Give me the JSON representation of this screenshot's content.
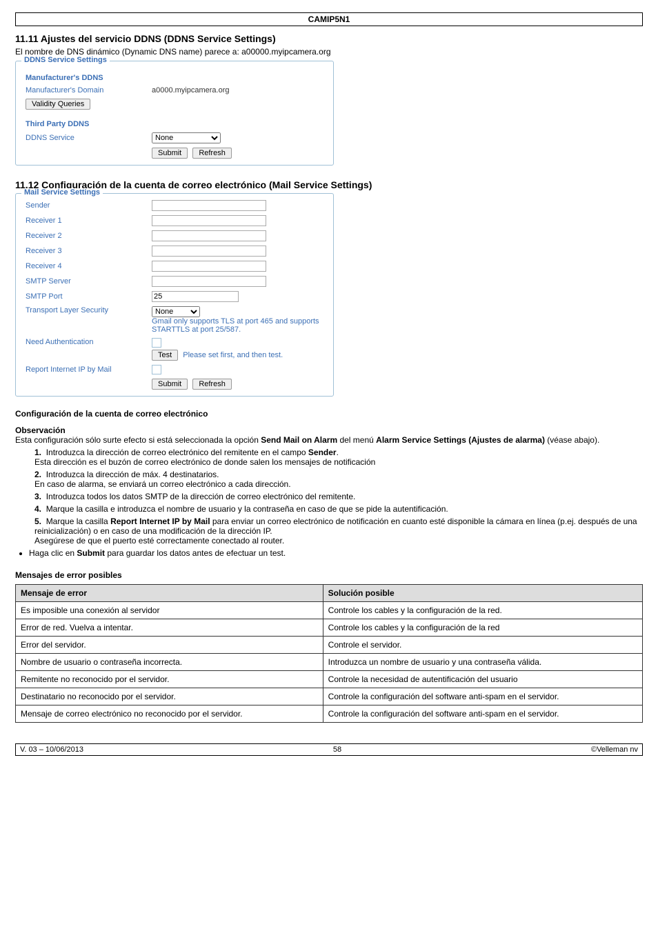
{
  "page_header": "CAMIP5N1",
  "section_1111": {
    "heading": "11.11 Ajustes del servicio DDNS (DDNS Service Settings)",
    "intro": "El nombre de DNS dinámico (Dynamic DNS name) parece a: a00000.myipcamera.org",
    "panel_title": "DDNS Service Settings",
    "group1_title": "Manufacturer's DDNS",
    "domain_label": "Manufacturer's Domain",
    "domain_value": "a0000.myipcamera.org",
    "validity_btn": "Validity Queries",
    "group2_title": "Third Party DDNS",
    "service_label": "DDNS Service",
    "service_value": "None",
    "submit": "Submit",
    "refresh": "Refresh"
  },
  "section_1112": {
    "heading": "11.12 Configuración de la cuenta de correo electrónico (Mail Service Settings)",
    "panel_title": "Mail Service Settings",
    "sender": "Sender",
    "r1": "Receiver 1",
    "r2": "Receiver 2",
    "r3": "Receiver 3",
    "r4": "Receiver 4",
    "smtp_server": "SMTP Server",
    "smtp_port": "SMTP Port",
    "smtp_port_val": "25",
    "tls": "Transport Layer Security",
    "tls_val": "None",
    "tls_note": "Gmail only supports TLS at port 465 and supports STARTTLS at port 25/587.",
    "need_auth": "Need Authentication",
    "test_btn": "Test",
    "test_note": "Please set first, and then test.",
    "report_ip": "Report Internet IP by Mail",
    "submit": "Submit",
    "refresh": "Refresh"
  },
  "config_heading": "Configuración de la cuenta de correo electrónico",
  "obs_label": "Observación",
  "obs_text_1": "Esta configuración sólo surte efecto si está seleccionada la opción ",
  "obs_bold_1": "Send Mail on Alarm",
  "obs_text_2": " del menú ",
  "obs_bold_2": "Alarm Service Settings (Ajustes de alarma)",
  "obs_text_3": " (véase abajo).",
  "steps": {
    "s1a": "Introduzca la dirección de correo electrónico del remitente en el campo ",
    "s1bold": "Sender",
    "s1b": ".",
    "s1c": "Esta dirección es el buzón de correo electrónico de donde salen los mensajes de notificación",
    "s2a": "Introduzca la dirección de máx. 4 destinatarios.",
    "s2b": "En caso de alarma, se enviará un correo electrónico a cada dirección.",
    "s3": "Introduzca todos los datos SMTP de la dirección de correo electrónico del remitente.",
    "s4": "Marque la casilla e introduzca el nombre de usuario y la contraseña en caso de que se pide la autentificación.",
    "s5a": "Marque la casilla ",
    "s5bold": "Report Internet IP by Mail",
    "s5b": " para enviar un correo electrónico de notificación en cuanto esté disponible la cámara en línea (p.ej. después de una reinicialización) o en caso de una modificación de la dirección IP.",
    "s5c": "Asegúrese de que el puerto esté correctamente conectado al router."
  },
  "bullet_a": "Haga clic en ",
  "bullet_bold": "Submit",
  "bullet_b": " para guardar los datos antes de efectuar un test.",
  "err_heading": "Mensajes de error posibles",
  "err_table": {
    "h1": "Mensaje de error",
    "h2": "Solución posible",
    "rows": [
      [
        "Es imposible una conexión al servidor",
        "Controle los cables y la configuración de la red."
      ],
      [
        "Error de red. Vuelva a intentar.",
        "Controle los cables y la configuración de la red"
      ],
      [
        "Error del servidor.",
        "Controle el servidor."
      ],
      [
        "Nombre de usuario o contraseña incorrecta.",
        "Introduzca un nombre de usuario y una contraseña válida."
      ],
      [
        "Remitente no reconocido por el servidor.",
        "Controle la necesidad de autentificación del usuario"
      ],
      [
        "Destinatario no reconocido por el servidor.",
        "Controle la configuración del software anti-spam en el servidor."
      ],
      [
        "Mensaje de correo electrónico no reconocido por el servidor.",
        "Controle la configuración del software anti-spam en el servidor."
      ]
    ]
  },
  "footer_left": "V. 03 – 10/06/2013",
  "footer_center": "58",
  "footer_right": "©Velleman nv"
}
